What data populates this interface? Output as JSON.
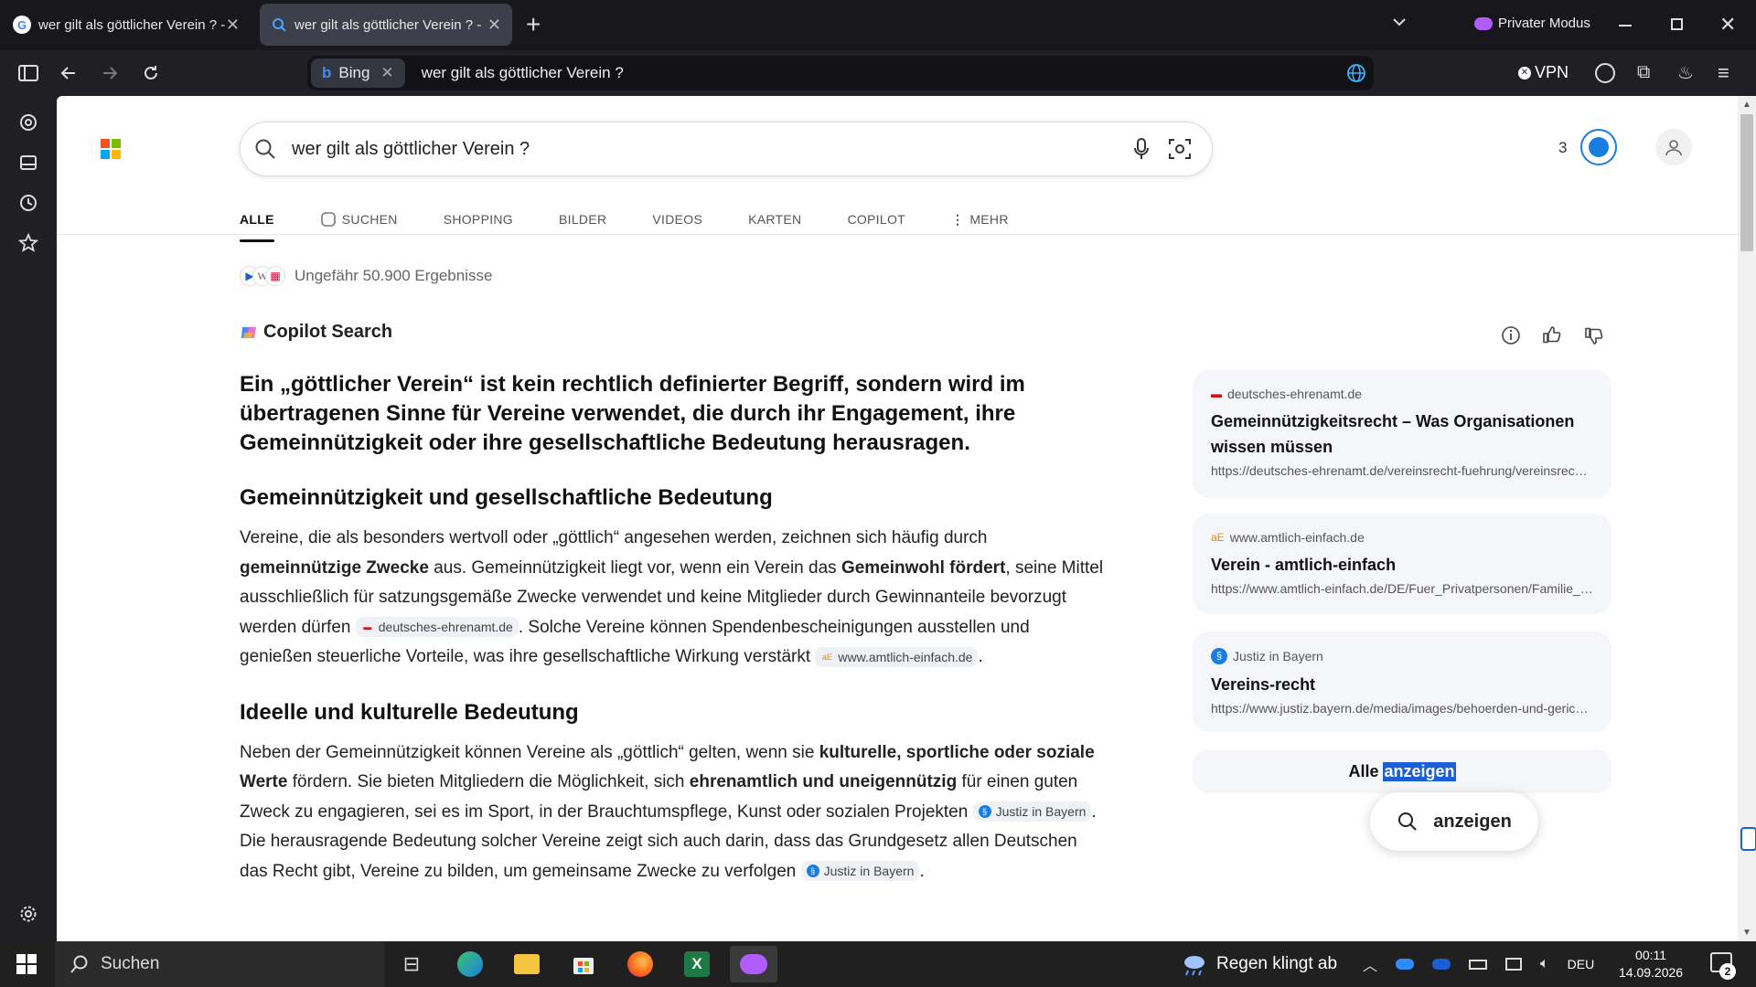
{
  "browser": {
    "tabs": [
      {
        "title": "wer gilt als göttlicher Verein ? -",
        "favicon": "google-icon",
        "active": false
      },
      {
        "title": "wer gilt als göttlicher Verein ? -",
        "favicon": "bing-search-icon",
        "active": true
      }
    ],
    "private_mode_label": "Privater Modus",
    "vpn_label": "VPN",
    "search_engine_chip": "Bing",
    "address_text": "wer gilt als göttlicher Verein ?"
  },
  "search": {
    "query": "wer gilt als göttlicher Verein ?",
    "reward_points": "3",
    "tabs": [
      {
        "label": "ALLE",
        "active": true
      },
      {
        "label": "SUCHEN",
        "icon": "copilot-search-icon"
      },
      {
        "label": "SHOPPING"
      },
      {
        "label": "BILDER"
      },
      {
        "label": "VIDEOS"
      },
      {
        "label": "KARTEN"
      },
      {
        "label": "COPILOT"
      },
      {
        "label": "MEHR",
        "icon": "more-dots-icon"
      }
    ],
    "results_count": "Ungefähr 50.900 Ergebnisse"
  },
  "answer": {
    "header": "Copilot Search",
    "lead": "Ein „göttlicher Verein“ ist kein rechtlich definierter Begriff, sondern wird im übertragenen Sinne für Vereine verwendet, die durch ihr Engagement, ihre Gemeinnützigkeit oder ihre gesellschaftliche Bedeutung herausragen.",
    "section1": {
      "heading": "Gemeinnützigkeit und gesellschaftliche Bedeutung",
      "t1": "Vereine, die als besonders wertvoll oder „göttlich“ angesehen werden, zeichnen sich häufig durch ",
      "b1": "gemeinnützige Zwecke",
      "t2": " aus. Gemeinnützigkeit liegt vor, wenn ein Verein das ",
      "b2": "Gemeinwohl fördert",
      "t3": ", seine Mittel ausschließlich für satzungsgemäße Zwecke verwendet und keine Mitglieder durch Gewinnanteile bevorzugt werden dürfen ",
      "cite1": "deutsches-ehrenamt.de",
      "t4": ". Solche Vereine können Spendenbescheinigungen ausstellen und genießen steuerliche Vorteile, was ihre gesellschaftliche Wirkung verstärkt ",
      "cite2": "www.amtlich-einfach.de",
      "t5": "."
    },
    "section2": {
      "heading": "Ideelle und kulturelle Bedeutung",
      "t1": "Neben der Gemeinnützigkeit können Vereine als „göttlich“ gelten, wenn sie ",
      "b1": "kulturelle, sportliche oder soziale Werte",
      "t2": " fördern. Sie bieten Mitgliedern die Möglichkeit, sich ",
      "b2": "ehrenamtlich und uneigennützig",
      "t3": " für einen guten Zweck zu engagieren, sei es im Sport, in der Brauchtumspflege, Kunst oder sozialen Projekten ",
      "cite1": "Justiz in Bayern",
      "t4": ". Die herausragende Bedeutung solcher Vereine zeigt sich auch darin, dass das Grundgesetz allen Deutschen das Recht gibt, Vereine zu bilden, um gemeinsame Zwecke zu verfolgen ",
      "cite2": "Justiz in Bayern",
      "t5": "."
    }
  },
  "sources": [
    {
      "domain": "deutsches-ehrenamt.de",
      "title": "Gemeinnützigkeitsrecht – Was Organisationen wissen müssen",
      "url": "https://deutsches-ehrenamt.de/vereinsrecht-fuehrung/vereinsrecht/..."
    },
    {
      "domain": "www.amtlich-einfach.de",
      "title": "Verein - amtlich-einfach",
      "url": "https://www.amtlich-einfach.de/DE/Fuer_Privatpersonen/Familie_u..."
    },
    {
      "domain": "Justiz in Bayern",
      "title": "Vereins-recht",
      "url": "https://www.justiz.bayern.de/media/images/behoerden-und-gericht..."
    }
  ],
  "show_all": {
    "pre": "Alle ",
    "selected": "anzeigen"
  },
  "popup": {
    "label": "anzeigen"
  },
  "taskbar": {
    "search_label": "Suchen",
    "weather": "Regen klingt ab",
    "language": "DEU",
    "time": "00:11",
    "date": "14.09.2026",
    "notifications": "2"
  },
  "colors": {
    "accent": "#1a5fd6",
    "tab_active": "#3c3f4a",
    "page_bg": "#ffffff"
  }
}
